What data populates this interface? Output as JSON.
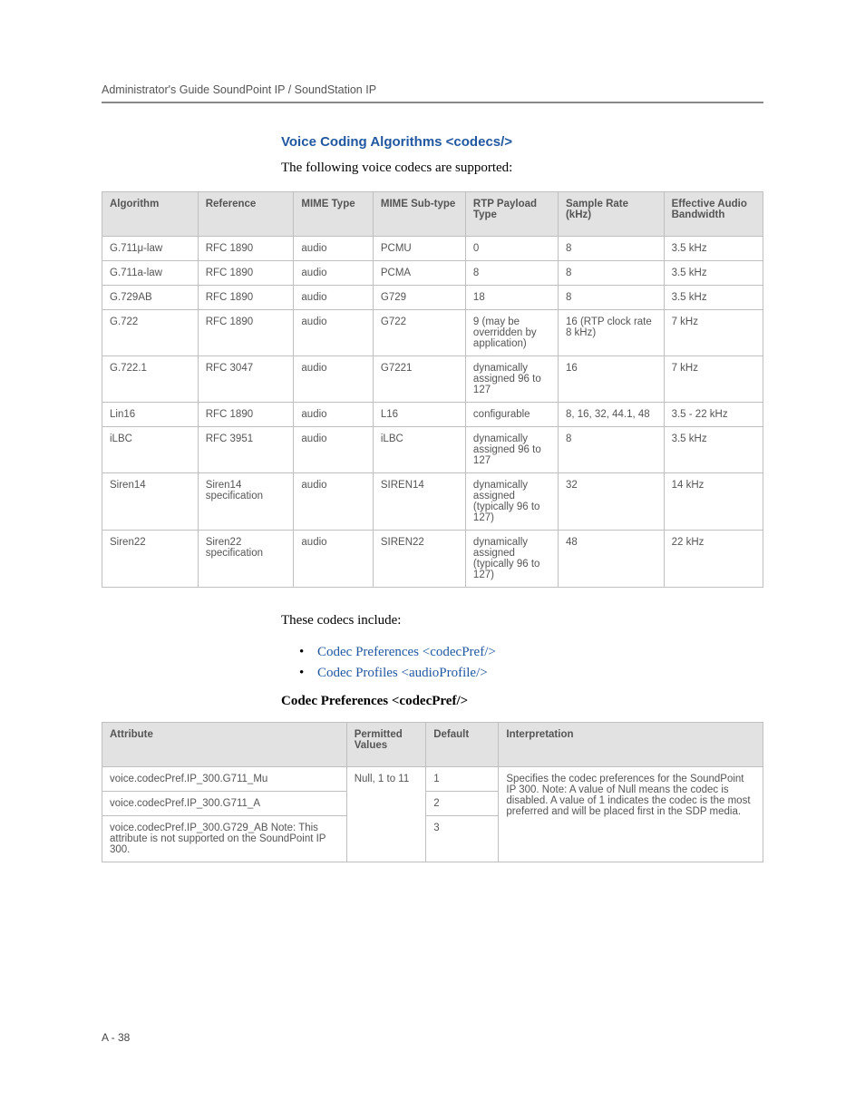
{
  "running_head": "Administrator's Guide SoundPoint IP / SoundStation IP",
  "section_title": "Voice Coding Algorithms <codecs/>",
  "intro_text": "The following voice codecs are supported:",
  "codec_table": {
    "headers": [
      "Algorithm",
      "Reference",
      "MIME Type",
      "MIME Sub-type",
      "RTP Payload Type",
      "Sample Rate (kHz)",
      "Effective Audio Bandwidth"
    ],
    "rows": [
      [
        "G.711μ-law",
        "RFC 1890",
        "audio",
        "PCMU",
        "0",
        "8",
        "3.5 kHz"
      ],
      [
        "G.711a-law",
        "RFC 1890",
        "audio",
        "PCMA",
        "8",
        "8",
        "3.5 kHz"
      ],
      [
        "G.729AB",
        "RFC 1890",
        "audio",
        "G729",
        "18",
        "8",
        "3.5 kHz"
      ],
      [
        "G.722",
        "RFC 1890",
        "audio",
        "G722",
        "9 (may be overridden by application)",
        "16 (RTP clock rate 8 kHz)",
        "7 kHz"
      ],
      [
        "G.722.1",
        "RFC 3047",
        "audio",
        "G7221",
        "dynamically assigned 96 to 127",
        "16",
        "7 kHz"
      ],
      [
        "Lin16",
        "RFC 1890",
        "audio",
        "L16",
        "configurable",
        "8, 16, 32, 44.1, 48",
        "3.5 - 22 kHz"
      ],
      [
        "iLBC",
        "RFC 3951",
        "audio",
        "iLBC",
        "dynamically assigned 96 to 127",
        "8",
        "3.5 kHz"
      ],
      [
        "Siren14",
        "Siren14 specification",
        "audio",
        "SIREN14",
        "dynamically assigned (typically 96 to 127)",
        "32",
        "14 kHz"
      ],
      [
        "Siren22",
        "Siren22 specification",
        "audio",
        "SIREN22",
        "dynamically assigned (typically 96 to 127)",
        "48",
        "22 kHz"
      ]
    ]
  },
  "these_include": "These codecs include:",
  "links": [
    "Codec Preferences <codecPref/>",
    "Codec Profiles <audioProfile/>"
  ],
  "sub_heading": "Codec Preferences <codecPref/>",
  "pref_table": {
    "headers": [
      "Attribute",
      "Permitted Values",
      "Default",
      "Interpretation"
    ],
    "rows": [
      {
        "attr": "voice.codecPref.IP_300.G711_Mu",
        "permitted": {
          "text": "Null, 1 to 11",
          "rowspan": 3
        },
        "default": "1",
        "interp": {
          "text": "Specifies the codec preferences for the SoundPoint IP 300. Note: A value of Null means the codec is disabled. A value of 1 indicates the codec is the most preferred and will be placed first in the SDP media.",
          "rowspan": 3
        }
      },
      {
        "attr": "voice.codecPref.IP_300.G711_A",
        "default": "2"
      },
      {
        "attr": "voice.codecPref.IP_300.G729_AB Note: This attribute is not supported on the SoundPoint IP 300.",
        "default": "3"
      }
    ]
  },
  "page_number": "A - 38"
}
